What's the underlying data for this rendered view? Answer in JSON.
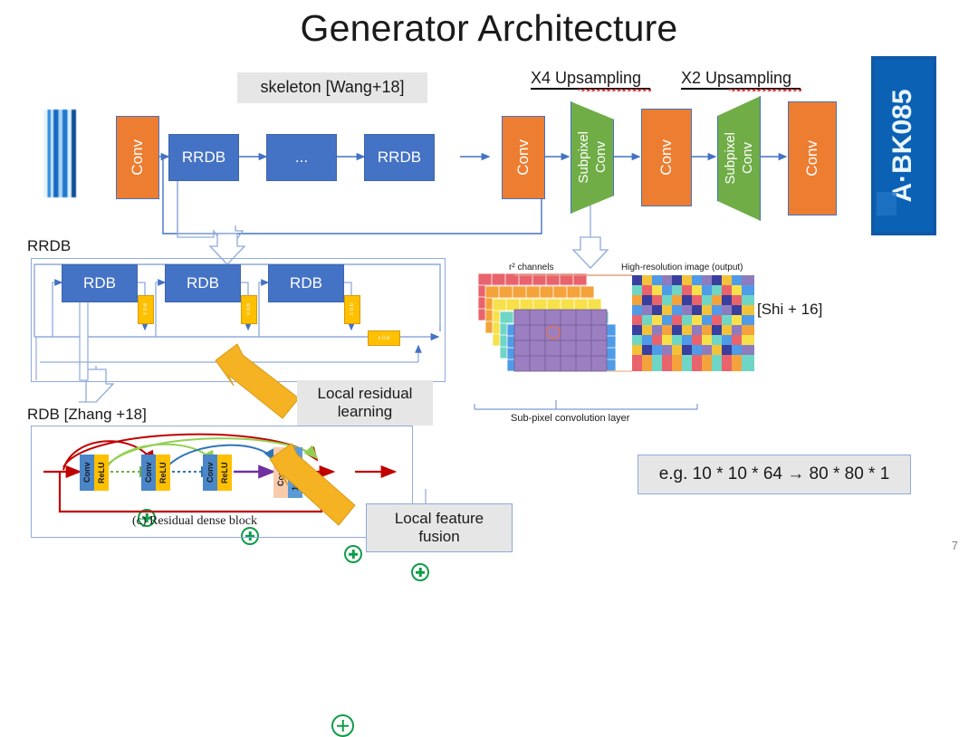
{
  "slide": {
    "title": "Generator Architecture",
    "number": "7"
  },
  "pipeline": {
    "skeleton_label": "skeleton [Wang+18]",
    "upsampling_x4": "X4 Upsampling",
    "upsampling_x2": "X2 Upsampling",
    "input_image_name": "low-resolution-license-plate",
    "output_image_name": "high-resolution-license-plate",
    "output_plate_text": "A·BK085",
    "blocks": [
      {
        "label": "Conv",
        "type": "conv"
      },
      {
        "label": "RRDB",
        "type": "rrdb"
      },
      {
        "label": "...",
        "type": "ellipsis"
      },
      {
        "label": "RRDB",
        "type": "rrdb"
      },
      {
        "label": "Conv",
        "type": "conv"
      },
      {
        "label": "Subpixel Conv",
        "type": "subpixel"
      },
      {
        "label": "Conv",
        "type": "conv"
      },
      {
        "label": "Subpixel Conv",
        "type": "subpixel"
      },
      {
        "label": "Conv",
        "type": "conv"
      }
    ],
    "subpixel_line1": "Subpixel",
    "subpixel_line2": "Conv"
  },
  "rrdb_panel": {
    "title": "RRDB",
    "blocks": [
      "RDB",
      "RDB",
      "RDB"
    ],
    "scale_label": "x 0.6",
    "plus_label": "+"
  },
  "rdb_panel": {
    "title": "RDB [Zhang +18]",
    "caption": "(c)  Residual dense block",
    "conv_label": "Conv",
    "relu_label": "ReLU",
    "concat_label": "Concat",
    "conv1x1_label": "1x1 Conv"
  },
  "callouts": {
    "local_residual": "Local residual\nlearning",
    "local_residual_line1": "Local residual",
    "local_residual_line2": "learning",
    "local_feature_line1": "Local feature",
    "local_feature_line2": "fusion"
  },
  "subpixel_diagram": {
    "left_label": "r² channels",
    "right_label": "High-resolution image (output)",
    "bottom_caption": "Sub-pixel convolution layer",
    "citation": "[Shi + 16]"
  },
  "example_note": {
    "text": "e.g. 10 * 10 * 64 → 80 * 80 * 1"
  },
  "colors": {
    "orange": "#ED7D31",
    "blue": "#4472C4",
    "green": "#70AD47",
    "yellow": "#FFC000",
    "plus_green": "#0f9d48",
    "gray_label": "#E7E6E6",
    "connector_blue": "#8FAADC",
    "callout_arrow": "#F5B324"
  }
}
